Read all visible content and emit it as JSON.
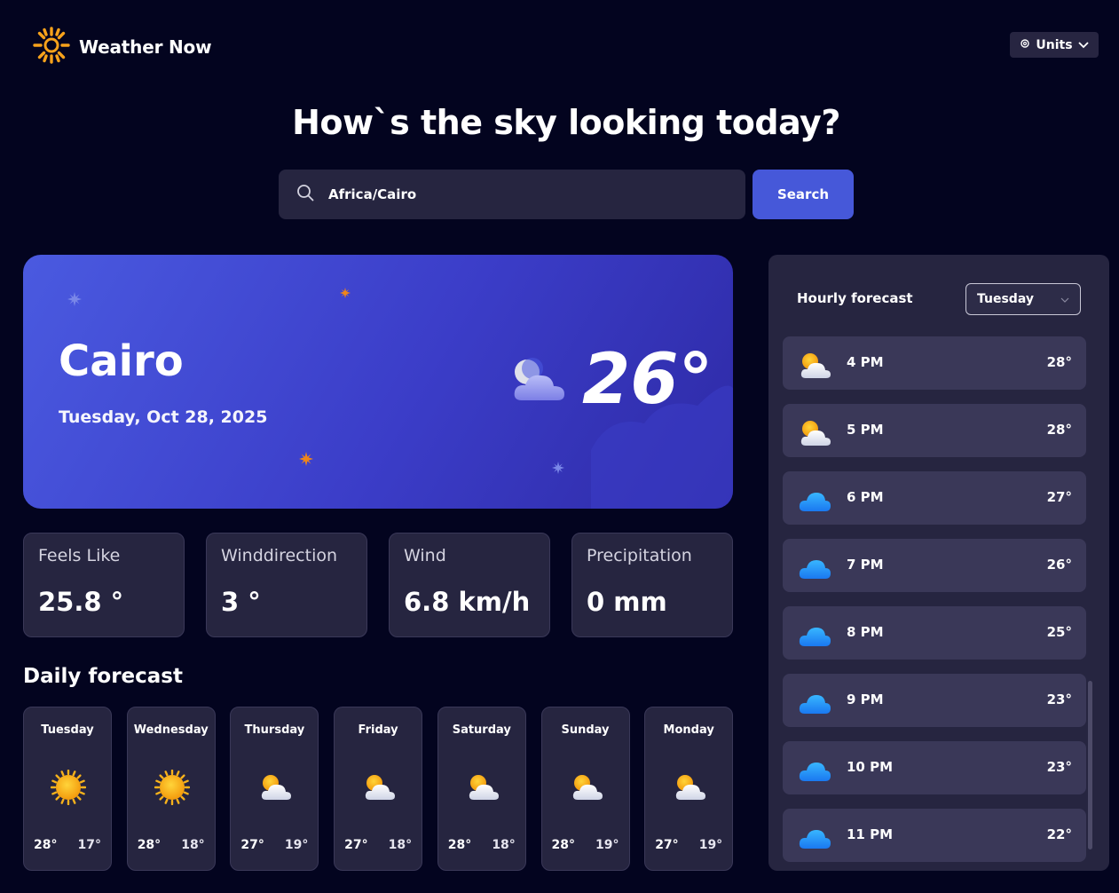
{
  "app": {
    "title": "Weather Now"
  },
  "header": {
    "units_label": "Units"
  },
  "headline": "How`s the sky looking today?",
  "search": {
    "value": "Africa/Cairo",
    "button_label": "Search"
  },
  "current": {
    "city": "Cairo",
    "date": "Tuesday, Oct 28, 2025",
    "temperature": "26°",
    "icon": "partly-cloudy-night-icon"
  },
  "stats": [
    {
      "label": "Feels Like",
      "value": "25.8 °"
    },
    {
      "label": "Winddirection",
      "value": "3 °"
    },
    {
      "label": "Wind",
      "value": "6.8 km/h"
    },
    {
      "label": "Precipitation",
      "value": "0 mm"
    }
  ],
  "daily": {
    "title": "Daily forecast",
    "days": [
      {
        "name": "Tuesday",
        "icon": "sun-icon",
        "high": "28°",
        "low": "17°"
      },
      {
        "name": "Wednesday",
        "icon": "sun-icon",
        "high": "28°",
        "low": "18°"
      },
      {
        "name": "Thursday",
        "icon": "partly-cloudy-icon",
        "high": "27°",
        "low": "19°"
      },
      {
        "name": "Friday",
        "icon": "partly-cloudy-icon",
        "high": "27°",
        "low": "18°"
      },
      {
        "name": "Saturday",
        "icon": "partly-cloudy-icon",
        "high": "28°",
        "low": "18°"
      },
      {
        "name": "Sunday",
        "icon": "partly-cloudy-icon",
        "high": "28°",
        "low": "19°"
      },
      {
        "name": "Monday",
        "icon": "partly-cloudy-icon",
        "high": "27°",
        "low": "19°"
      }
    ]
  },
  "hourly": {
    "title": "Hourly forecast",
    "selected_day": "Tuesday",
    "hours": [
      {
        "time": "4 PM",
        "temp": "28°",
        "icon": "partly-cloudy-icon"
      },
      {
        "time": "5 PM",
        "temp": "28°",
        "icon": "partly-cloudy-icon"
      },
      {
        "time": "6 PM",
        "temp": "27°",
        "icon": "cloud-icon"
      },
      {
        "time": "7 PM",
        "temp": "26°",
        "icon": "cloud-icon"
      },
      {
        "time": "8 PM",
        "temp": "25°",
        "icon": "cloud-icon"
      },
      {
        "time": "9 PM",
        "temp": "23°",
        "icon": "cloud-icon"
      },
      {
        "time": "10 PM",
        "temp": "23°",
        "icon": "cloud-icon"
      },
      {
        "time": "11 PM",
        "temp": "22°",
        "icon": "cloud-icon"
      }
    ]
  },
  "colors": {
    "background": "#03041f",
    "card": "#262540",
    "accent": "#4658d9",
    "sun": "#f7a21b"
  }
}
